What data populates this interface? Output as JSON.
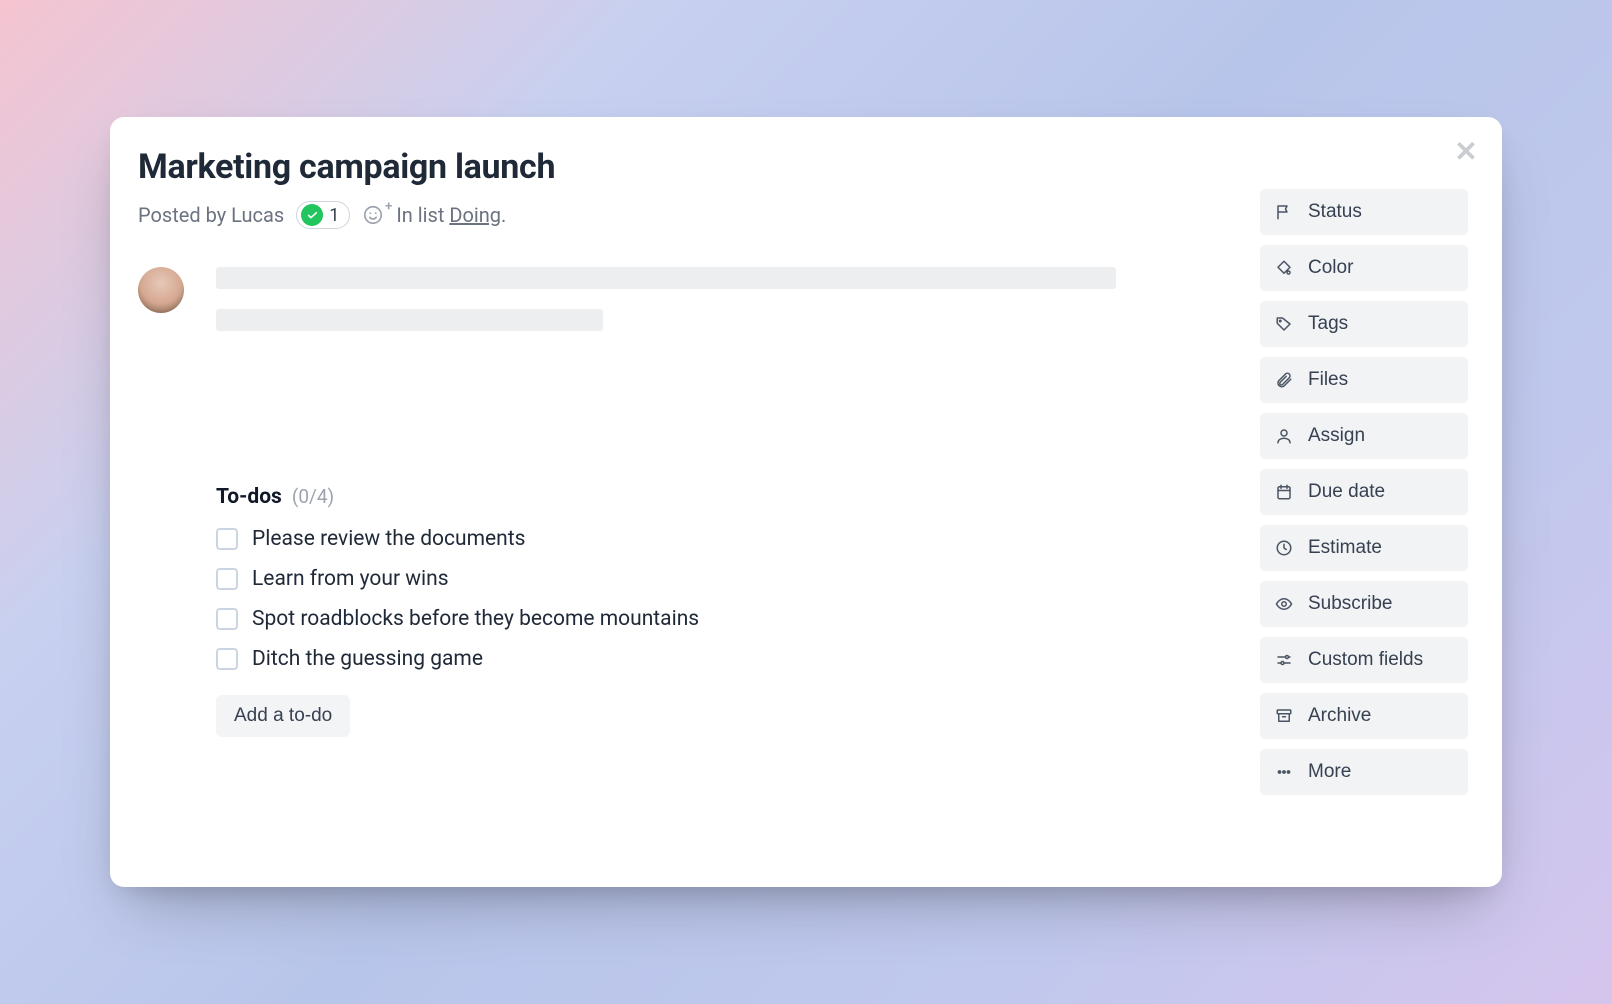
{
  "card": {
    "title": "Marketing campaign launch",
    "posted_by_prefix": "Posted by ",
    "posted_by_name": "Lucas",
    "badge_count": "1",
    "in_list_prefix": "In list ",
    "list_name": "Doing",
    "list_suffix": "."
  },
  "todos": {
    "title": "To-dos",
    "count": "(0/4)",
    "items": [
      "Please review the documents",
      "Learn from your wins",
      "Spot roadblocks before they become mountains",
      "Ditch the guessing game"
    ],
    "add_label": "Add a to-do"
  },
  "sidebar": {
    "status": "Status",
    "color": "Color",
    "tags": "Tags",
    "files": "Files",
    "assign": "Assign",
    "due_date": "Due date",
    "estimate": "Estimate",
    "subscribe": "Subscribe",
    "custom_fields": "Custom fields",
    "archive": "Archive",
    "more": "More"
  }
}
